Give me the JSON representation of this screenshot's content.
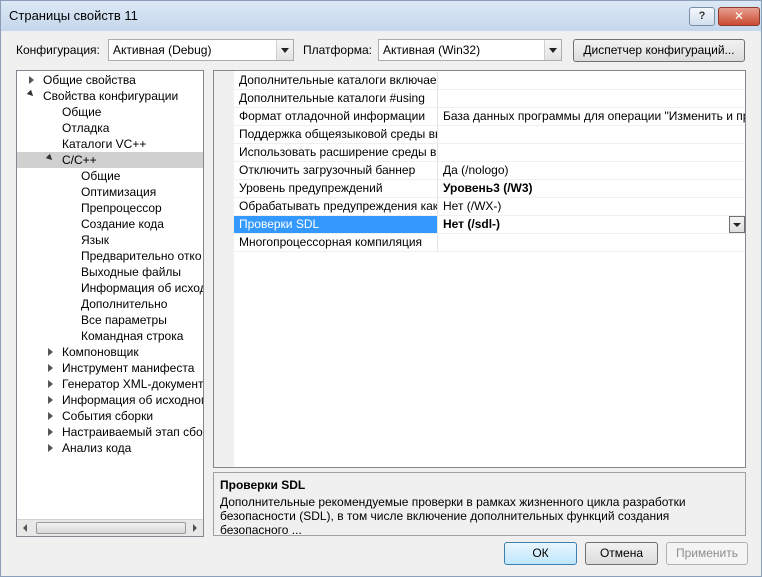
{
  "window": {
    "title": "Страницы свойств 11",
    "help_label": "?",
    "close_label": "✕"
  },
  "config": {
    "config_label": "Конфигурация:",
    "config_value": "Активная (Debug)",
    "platform_label": "Платформа:",
    "platform_value": "Активная (Win32)",
    "manager_button": "Диспетчер конфигураций..."
  },
  "tree": {
    "items": [
      {
        "label": "Общие свойства"
      },
      {
        "label": "Свойства конфигурации"
      },
      {
        "label": "Общие"
      },
      {
        "label": "Отладка"
      },
      {
        "label": "Каталоги VC++"
      },
      {
        "label": "C/C++"
      },
      {
        "label": "Общие"
      },
      {
        "label": "Оптимизация"
      },
      {
        "label": "Препроцессор"
      },
      {
        "label": "Создание кода"
      },
      {
        "label": "Язык"
      },
      {
        "label": "Предварительно отко"
      },
      {
        "label": "Выходные файлы"
      },
      {
        "label": "Информация об исход"
      },
      {
        "label": "Дополнительно"
      },
      {
        "label": "Все параметры"
      },
      {
        "label": "Командная строка"
      },
      {
        "label": "Компоновщик"
      },
      {
        "label": "Инструмент манифеста"
      },
      {
        "label": "Генератор XML-документ"
      },
      {
        "label": "Информация об исходном"
      },
      {
        "label": "События сборки"
      },
      {
        "label": "Настраиваемый этап сбор"
      },
      {
        "label": "Анализ кода"
      }
    ]
  },
  "grid": {
    "rows": [
      {
        "name": "Дополнительные каталоги включаем",
        "value": ""
      },
      {
        "name": "Дополнительные каталоги #using",
        "value": ""
      },
      {
        "name": "Формат отладочной информации",
        "value": "База данных программы для операции \"Изменить и про"
      },
      {
        "name": "Поддержка общеязыковой среды вы",
        "value": ""
      },
      {
        "name": "Использовать расширение среды вы",
        "value": ""
      },
      {
        "name": "Отключить загрузочный баннер",
        "value": "Да (/nologo)"
      },
      {
        "name": "Уровень предупреждений",
        "value": "Уровень3 (/W3)"
      },
      {
        "name": "Обрабатывать предупреждения как",
        "value": "Нет (/WX-)"
      },
      {
        "name": "Проверки SDL",
        "value": "Нет (/sdl-)"
      },
      {
        "name": "Многопроцессорная компиляция",
        "value": ""
      }
    ]
  },
  "description": {
    "title": "Проверки SDL",
    "text": "Дополнительные рекомендуемые проверки в рамках жизненного цикла разработки безопасности (SDL), в том числе включение дополнительных функций создания безопасного ..."
  },
  "buttons": {
    "ok": "ОК",
    "cancel": "Отмена",
    "apply": "Применить"
  },
  "colors": {
    "selection": "#3399ff",
    "title_bar": "#dce8f5",
    "close": "#c94a32"
  }
}
